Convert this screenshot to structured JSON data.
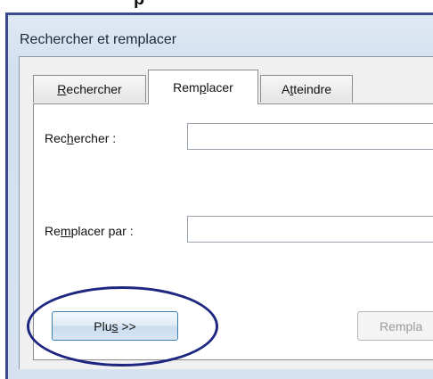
{
  "window": {
    "title": "Rechercher et remplacer"
  },
  "tabs": [
    {
      "label_pre": "",
      "label_accel": "R",
      "label_post": "echercher",
      "active": false
    },
    {
      "label_pre": "Rem",
      "label_accel": "p",
      "label_post": "lacer",
      "active": true
    },
    {
      "label_pre": "A",
      "label_accel": "t",
      "label_post": "teindre",
      "active": false
    }
  ],
  "form": {
    "find_label_pre": "Rec",
    "find_label_accel": "h",
    "find_label_post": "ercher :",
    "find_value": "",
    "replace_label_pre": "Re",
    "replace_label_accel": "m",
    "replace_label_post": "placer par :",
    "replace_value": ""
  },
  "buttons": {
    "more_pre": "Plu",
    "more_accel": "s",
    "more_post": " >>",
    "replace_partial": "Rempla"
  },
  "colors": {
    "highlight_ring": "#1d2680",
    "frame_border": "#3a4a8a",
    "more_button_border": "#3c7fb1"
  }
}
